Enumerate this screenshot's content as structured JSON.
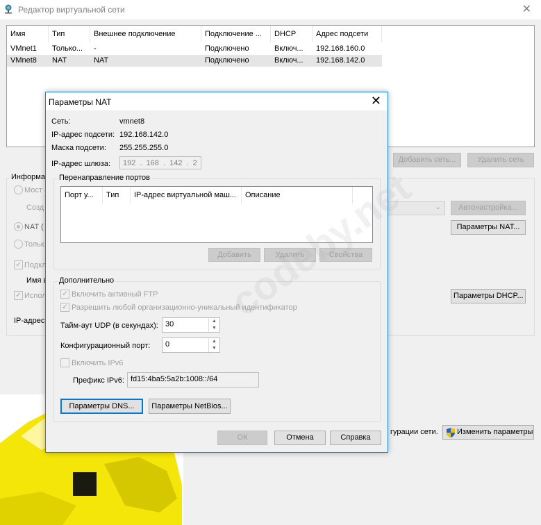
{
  "main": {
    "title": "Редактор виртуальной сети",
    "columns": [
      "Имя",
      "Тип",
      "Внешнее подключение",
      "Подключение ...",
      "DHCP",
      "Адрес подсети"
    ],
    "rows": [
      [
        "VMnet1",
        "Только...",
        "-",
        "Подключено",
        "Включ...",
        "192.168.160.0"
      ],
      [
        "VMnet8",
        "NAT",
        "NAT",
        "Подключено",
        "Включ...",
        "192.168.142.0"
      ]
    ],
    "add_network": "Добавить сеть...",
    "remove_network": "Удалить сеть",
    "info_label": "Информа",
    "bridge_label": "Мост (",
    "create_label": "Созд",
    "nat_label": "NAT (",
    "host_only_label": "Тольк",
    "connect_label": "Подкл",
    "adapter_name_label": "Имя в",
    "use_label": "Испол",
    "subnet_ip_label": "IP-адрес",
    "auto_settings": "Автонастройка...",
    "nat_settings": "Параметры NAT...",
    "dhcp_settings": "Параметры DHCP...",
    "config_text": "гурации сети.",
    "change_settings": "Изменить параметры"
  },
  "nat": {
    "title": "Параметры NAT",
    "network_label": "Сеть:",
    "network_value": "vmnet8",
    "subnet_ip_label": "IP-адрес подсети:",
    "subnet_ip_value": "192.168.142.0",
    "mask_label": "Маска подсети:",
    "mask_value": "255.255.255.0",
    "gateway_label": "IP-адрес шлюза:",
    "gateway_octets": [
      "192",
      "168",
      "142",
      "2"
    ],
    "port_forward_title": "Перенаправление портов",
    "port_columns": [
      "Порт у...",
      "Тип",
      "IP-адрес виртуальной маш...",
      "Описание"
    ],
    "add": "Добавить",
    "remove": "Удалить",
    "properties": "Свойства",
    "advanced_title": "Дополнительно",
    "enable_ftp": "Включить активный FTP",
    "allow_oui": "Разрешить любой организационно-уникальный идентификатор",
    "udp_timeout_label": "Тайм-аут UDP (в секундах):",
    "udp_timeout_value": "30",
    "config_port_label": "Конфигурационный порт:",
    "config_port_value": "0",
    "enable_ipv6": "Включить IPv6",
    "ipv6_prefix_label": "Префикс IPv6:",
    "ipv6_prefix_value": "fd15:4ba5:5a2b:1008::/64",
    "dns_settings": "Параметры DNS...",
    "netbios_settings": "Параметры NetBios...",
    "ok": "ОК",
    "cancel": "Отмена",
    "help": "Справка"
  },
  "watermark": "codeby.net",
  "colors": {
    "accent": "#0078d7",
    "dialog_border": "#1883d7",
    "selected_row": "#e5e5e5",
    "yellow": "#f5e60a"
  }
}
